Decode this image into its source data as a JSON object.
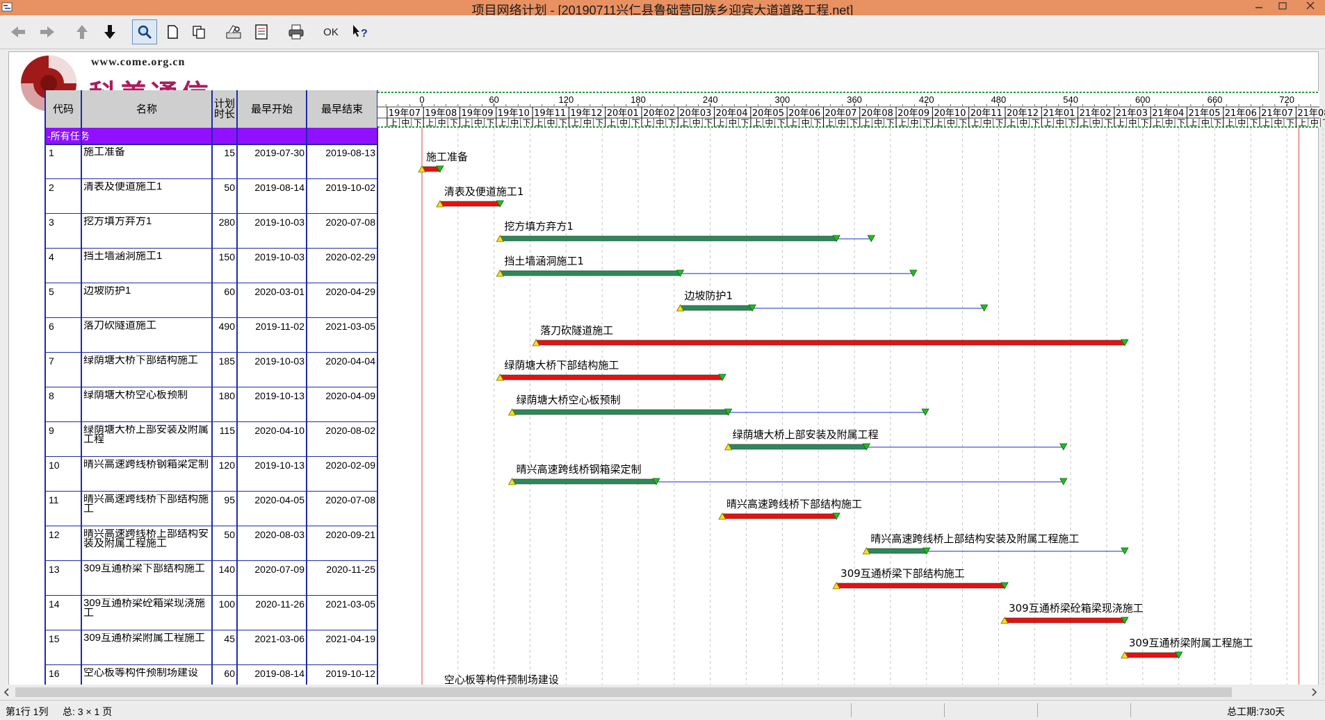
{
  "window": {
    "title": "项目网络计划 - [20190711兴仁县鲁础营回族乡迎宾大道道路工程.net]"
  },
  "toolbar": {
    "ok_label": "OK"
  },
  "logo": {
    "url": "www.come.org.cn",
    "brand": "科美通信"
  },
  "columns": {
    "code": "代码",
    "name": "名称",
    "duration": "计划时长",
    "start": "最早开始",
    "end": "最早结束"
  },
  "group_label": "-所有任务",
  "timeline": {
    "day_ticks": [
      "0",
      "60",
      "120",
      "180",
      "240",
      "300",
      "360",
      "420",
      "480",
      "540",
      "600",
      "660",
      "720"
    ],
    "months": [
      "19年07",
      "19年08",
      "19年09",
      "19年10",
      "19年11",
      "19年12",
      "20年01",
      "20年02",
      "20年03",
      "20年04",
      "20年05",
      "20年06",
      "20年07",
      "20年08",
      "20年09",
      "20年10",
      "20年11",
      "20年12",
      "21年01",
      "21年02",
      "21年03",
      "21年04",
      "21年05",
      "21年06",
      "21年07",
      "21年08"
    ],
    "thirds": [
      "上",
      "中",
      "下"
    ]
  },
  "tasks": [
    {
      "code": "1",
      "name": "施工准备",
      "duration": "15",
      "start": "2019-07-30",
      "end": "2019-08-13",
      "es": 0,
      "dur": 15,
      "float": 0,
      "critical": true
    },
    {
      "code": "2",
      "name": "清表及便道施工1",
      "duration": "50",
      "start": "2019-08-14",
      "end": "2019-10-02",
      "es": 15,
      "dur": 50,
      "float": 0,
      "critical": true
    },
    {
      "code": "3",
      "name": "挖方填方弃方1",
      "duration": "280",
      "start": "2019-10-03",
      "end": "2020-07-08",
      "es": 65,
      "dur": 280,
      "float": 29,
      "critical": false
    },
    {
      "code": "4",
      "name": "挡土墙涵洞施工1",
      "duration": "150",
      "start": "2019-10-03",
      "end": "2020-02-29",
      "es": 65,
      "dur": 150,
      "float": 194,
      "critical": false
    },
    {
      "code": "5",
      "name": "边坡防护1",
      "duration": "60",
      "start": "2020-03-01",
      "end": "2020-04-29",
      "es": 215,
      "dur": 60,
      "float": 193,
      "critical": false
    },
    {
      "code": "6",
      "name": "落刀砍隧道施工",
      "duration": "490",
      "start": "2019-11-02",
      "end": "2021-03-05",
      "es": 95,
      "dur": 490,
      "float": 0,
      "critical": true
    },
    {
      "code": "7",
      "name": "绿荫塘大桥下部结构施工",
      "duration": "185",
      "start": "2019-10-03",
      "end": "2020-04-04",
      "es": 65,
      "dur": 185,
      "float": 0,
      "critical": true
    },
    {
      "code": "8",
      "name": "绿荫塘大桥空心板预制",
      "duration": "180",
      "start": "2019-10-13",
      "end": "2020-04-09",
      "es": 75,
      "dur": 180,
      "float": 164,
      "critical": false
    },
    {
      "code": "9",
      "name": "绿荫塘大桥上部安装及附属工程",
      "duration": "115",
      "start": "2020-04-10",
      "end": "2020-08-02",
      "es": 255,
      "dur": 115,
      "float": 164,
      "critical": false
    },
    {
      "code": "10",
      "name": "晴兴高速跨线桥钢箱梁定制",
      "duration": "120",
      "start": "2019-10-13",
      "end": "2020-02-09",
      "es": 75,
      "dur": 120,
      "float": 339,
      "critical": false
    },
    {
      "code": "11",
      "name": "晴兴高速跨线桥下部结构施工",
      "duration": "95",
      "start": "2020-04-05",
      "end": "2020-07-08",
      "es": 250,
      "dur": 95,
      "float": 0,
      "critical": true
    },
    {
      "code": "12",
      "name": "晴兴高速跨线桥上部结构安装及附属工程施工",
      "duration": "50",
      "start": "2020-08-03",
      "end": "2020-09-21",
      "es": 370,
      "dur": 50,
      "float": 165,
      "critical": false
    },
    {
      "code": "13",
      "name": "309互通桥梁下部结构施工",
      "duration": "140",
      "start": "2020-07-09",
      "end": "2020-11-25",
      "es": 345,
      "dur": 140,
      "float": 0,
      "critical": true
    },
    {
      "code": "14",
      "name": "309互通桥梁砼箱梁现浇施工",
      "duration": "100",
      "start": "2020-11-26",
      "end": "2021-03-05",
      "es": 485,
      "dur": 100,
      "float": 0,
      "critical": true
    },
    {
      "code": "15",
      "name": "309互通桥梁附属工程施工",
      "duration": "45",
      "start": "2021-03-06",
      "end": "2021-04-19",
      "es": 585,
      "dur": 45,
      "float": 0,
      "critical": true
    },
    {
      "code": "16",
      "name": "空心板等构件预制场建设",
      "duration": "60",
      "start": "2019-08-14",
      "end": "2019-10-12",
      "es": 15,
      "dur": 60,
      "float": 0,
      "critical": false
    }
  ],
  "status": {
    "position": "第1行 1列",
    "pages": "总: 3 × 1 页",
    "total_duration": "总工期:730天"
  },
  "colors": {
    "critical": "#e8100e",
    "noncritical": "#2b8a57",
    "float_line": "#1a2ad0",
    "group_bg": "#8f11ff",
    "grid_blue": "#1e2aa8",
    "titlebar": "#e89162",
    "start_marker": "#f3e21c",
    "end_marker": "#22bb22"
  }
}
